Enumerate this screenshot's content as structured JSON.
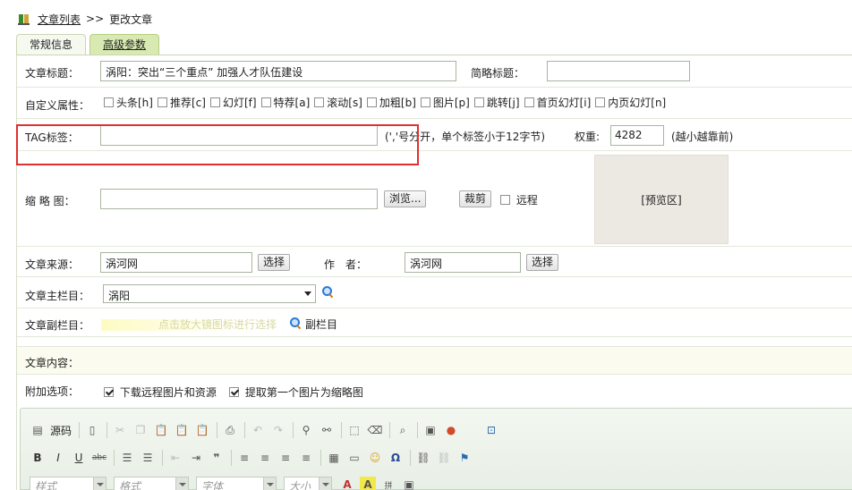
{
  "breadcrumb": {
    "list_link": "文章列表",
    "separator": ">>",
    "current": "更改文章"
  },
  "tabs": [
    {
      "label": "常规信息"
    },
    {
      "label": "高级参数"
    }
  ],
  "title_row": {
    "label": "文章标题：",
    "value": "涡阳：突出“三个重点” 加强人才队伍建设",
    "short_label": "简略标题：",
    "short_value": ""
  },
  "attrs": {
    "label": "自定义属性：",
    "items": [
      "头条[h]",
      "推荐[c]",
      "幻灯[f]",
      "特荐[a]",
      "滚动[s]",
      "加粗[b]",
      "图片[p]",
      "跳转[j]",
      "首页幻灯[i]",
      "内页幻灯[n]"
    ]
  },
  "tag_row": {
    "label": "TAG标签：",
    "value": "",
    "hint": "(','号分开，单个标签小于12字节)",
    "weight_label": "权重:",
    "weight_value": "4282",
    "weight_hint": "(越小越靠前)"
  },
  "thumb_row": {
    "label": "缩 略 图：",
    "browse": "浏览...",
    "crop": "裁剪",
    "remote": "远程",
    "preview": "[预览区]"
  },
  "source_row": {
    "label": "文章来源：",
    "value": "涡河网",
    "select": "选择",
    "author_label": "作　者：",
    "author_value": "涡河网",
    "author_select": "选择"
  },
  "column_row": {
    "label": "文章主栏目：",
    "value": "涡阳"
  },
  "sub_row": {
    "label": "文章副栏目：",
    "hint": "点击放大镜图标进行选择",
    "link": "副栏目"
  },
  "content_row": {
    "label": "文章内容："
  },
  "options_row": {
    "label": "附加选项：",
    "opt1": "下载远程图片和资源",
    "opt2": "提取第一个图片为缩略图"
  },
  "editor": {
    "source": "源码",
    "combos": [
      "样式",
      "格式",
      "字体",
      "大小"
    ]
  },
  "colors": {
    "accent_tab": "#d8eab1",
    "highlight_box": "#e03030",
    "content_bg": "#fbfcef"
  }
}
